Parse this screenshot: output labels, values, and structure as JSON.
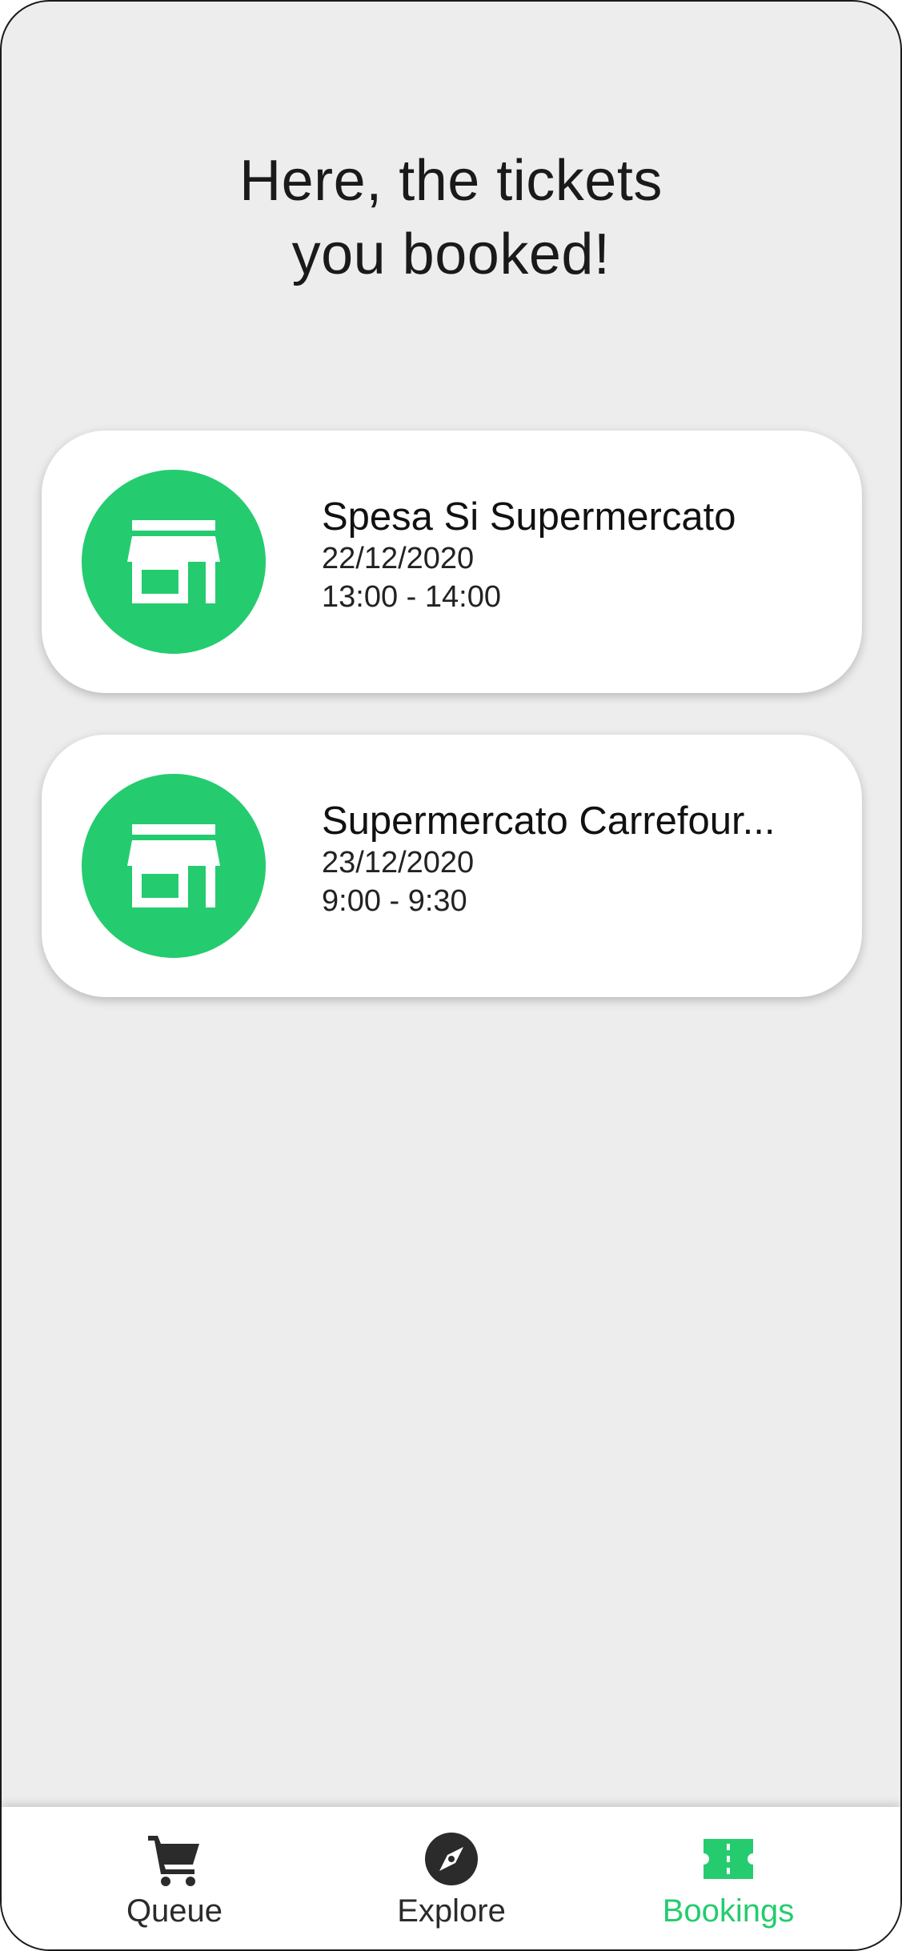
{
  "header": {
    "title_line1": "Here, the tickets",
    "title_line2": "you booked!"
  },
  "bookings": [
    {
      "icon": "store-icon",
      "name": "Spesa Si Supermercato",
      "date": "22/12/2020",
      "time": "13:00 - 14:00"
    },
    {
      "icon": "store-icon",
      "name": "Supermercato Carrefour...",
      "date": "23/12/2020",
      "time": "9:00 - 9:30"
    }
  ],
  "nav": {
    "items": [
      {
        "label": "Queue",
        "icon": "cart-icon",
        "active": false
      },
      {
        "label": "Explore",
        "icon": "compass-icon",
        "active": false
      },
      {
        "label": "Bookings",
        "icon": "ticket-icon",
        "active": true
      }
    ]
  },
  "colors": {
    "accent": "#24cc6f",
    "background": "#ededed",
    "card": "#ffffff",
    "text": "#1a1a1a"
  }
}
